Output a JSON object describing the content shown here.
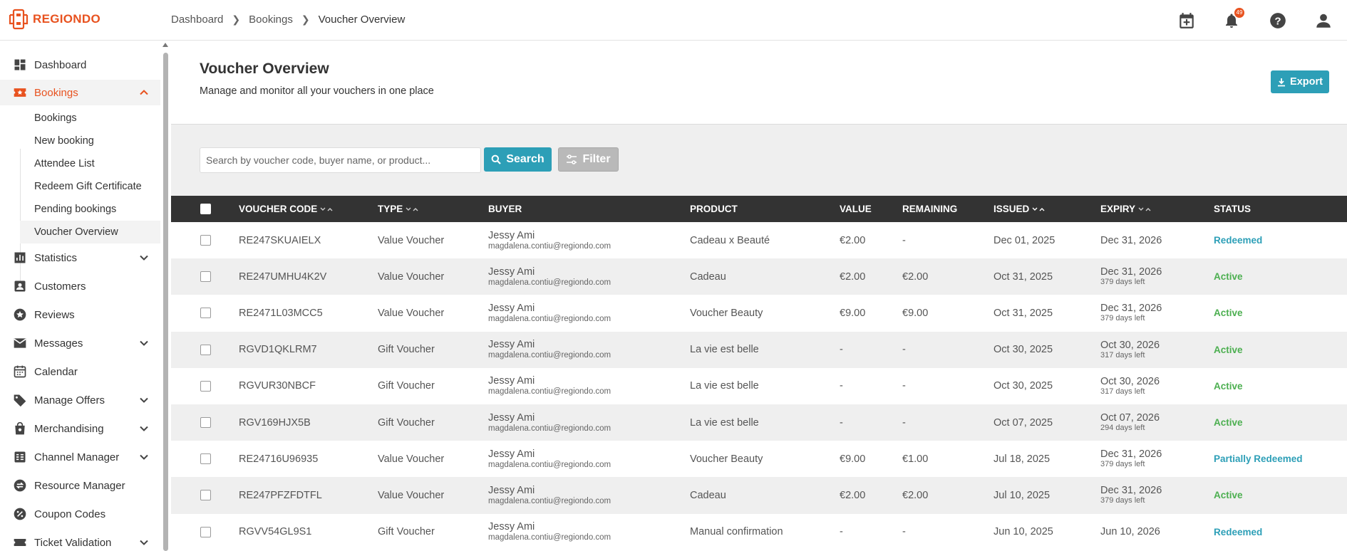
{
  "brand": {
    "name": "REGIONDO",
    "accent": "#e8521f",
    "primary": "#2d9fb7"
  },
  "breadcrumb": [
    "Dashboard",
    "Bookings",
    "Voucher Overview"
  ],
  "notifications": {
    "count": "49"
  },
  "sidebar": {
    "items": [
      {
        "label": "Dashboard",
        "icon": "dashboard-icon"
      },
      {
        "label": "Bookings",
        "icon": "bookings-icon",
        "expanded": true
      },
      {
        "label": "Statistics",
        "icon": "statistics-icon"
      },
      {
        "label": "Customers",
        "icon": "customers-icon"
      },
      {
        "label": "Reviews",
        "icon": "reviews-icon"
      },
      {
        "label": "Messages",
        "icon": "messages-icon"
      },
      {
        "label": "Calendar",
        "icon": "calendar-icon"
      },
      {
        "label": "Manage Offers",
        "icon": "tag-icon"
      },
      {
        "label": "Merchandising",
        "icon": "bag-icon"
      },
      {
        "label": "Channel Manager",
        "icon": "channel-icon"
      },
      {
        "label": "Resource Manager",
        "icon": "resource-icon"
      },
      {
        "label": "Coupon Codes",
        "icon": "coupon-icon"
      },
      {
        "label": "Ticket Validation",
        "icon": "ticket-icon"
      }
    ],
    "sub_items": [
      "Bookings",
      "New booking",
      "Attendee List",
      "Redeem Gift Certificate",
      "Pending bookings",
      "Voucher Overview"
    ]
  },
  "page": {
    "title": "Voucher Overview",
    "subtitle": "Manage and monitor all your vouchers in one place",
    "export_label": "Export"
  },
  "search": {
    "placeholder": "Search by voucher code, buyer name, or product...",
    "search_label": "Search",
    "filter_label": "Filter"
  },
  "table": {
    "columns": [
      "VOUCHER CODE",
      "TYPE",
      "BUYER",
      "PRODUCT",
      "VALUE",
      "REMAINING",
      "ISSUED",
      "EXPIRY",
      "STATUS"
    ],
    "rows": [
      {
        "code": "RE247SKUAIELX",
        "type": "Value Voucher",
        "buyer": "Jessy Ami",
        "email": "magdalena.contiu@regiondo.com",
        "product": "Cadeau x Beauté",
        "value": "€2.00",
        "remaining": "-",
        "issued": "Dec 01, 2025",
        "expiry": "Dec 31, 2026",
        "days_left": "",
        "status": "Redeemed",
        "status_class": "st-redeemed"
      },
      {
        "code": "RE247UMHU4K2V",
        "type": "Value Voucher",
        "buyer": "Jessy Ami",
        "email": "magdalena.contiu@regiondo.com",
        "product": "Cadeau",
        "value": "€2.00",
        "remaining": "€2.00",
        "issued": "Oct 31, 2025",
        "expiry": "Dec 31, 2026",
        "days_left": "379 days left",
        "status": "Active",
        "status_class": "st-active"
      },
      {
        "code": "RE2471L03MCC5",
        "type": "Value Voucher",
        "buyer": "Jessy Ami",
        "email": "magdalena.contiu@regiondo.com",
        "product": "Voucher Beauty",
        "value": "€9.00",
        "remaining": "€9.00",
        "issued": "Oct 31, 2025",
        "expiry": "Dec 31, 2026",
        "days_left": "379 days left",
        "status": "Active",
        "status_class": "st-active"
      },
      {
        "code": "RGVD1QKLRM7",
        "type": "Gift Voucher",
        "buyer": "Jessy Ami",
        "email": "magdalena.contiu@regiondo.com",
        "product": "La vie est belle",
        "value": "-",
        "remaining": "-",
        "issued": "Oct 30, 2025",
        "expiry": "Oct 30, 2026",
        "days_left": "317 days left",
        "status": "Active",
        "status_class": "st-active"
      },
      {
        "code": "RGVUR30NBCF",
        "type": "Gift Voucher",
        "buyer": "Jessy Ami",
        "email": "magdalena.contiu@regiondo.com",
        "product": "La vie est belle",
        "value": "-",
        "remaining": "-",
        "issued": "Oct 30, 2025",
        "expiry": "Oct 30, 2026",
        "days_left": "317 days left",
        "status": "Active",
        "status_class": "st-active"
      },
      {
        "code": "RGV169HJX5B",
        "type": "Gift Voucher",
        "buyer": "Jessy Ami",
        "email": "magdalena.contiu@regiondo.com",
        "product": "La vie est belle",
        "value": "-",
        "remaining": "-",
        "issued": "Oct 07, 2025",
        "expiry": "Oct 07, 2026",
        "days_left": "294 days left",
        "status": "Active",
        "status_class": "st-active"
      },
      {
        "code": "RE24716U96935",
        "type": "Value Voucher",
        "buyer": "Jessy Ami",
        "email": "magdalena.contiu@regiondo.com",
        "product": "Voucher Beauty",
        "value": "€9.00",
        "remaining": "€1.00",
        "issued": "Jul 18, 2025",
        "expiry": "Dec 31, 2026",
        "days_left": "379 days left",
        "status": "Partially Redeemed",
        "status_class": "st-partial"
      },
      {
        "code": "RE247PFZFDTFL",
        "type": "Value Voucher",
        "buyer": "Jessy Ami",
        "email": "magdalena.contiu@regiondo.com",
        "product": "Cadeau",
        "value": "€2.00",
        "remaining": "€2.00",
        "issued": "Jul 10, 2025",
        "expiry": "Dec 31, 2026",
        "days_left": "379 days left",
        "status": "Active",
        "status_class": "st-active"
      },
      {
        "code": "RGVV54GL9S1",
        "type": "Gift Voucher",
        "buyer": "Jessy Ami",
        "email": "magdalena.contiu@regiondo.com",
        "product": "Manual confirmation",
        "value": "-",
        "remaining": "-",
        "issued": "Jun 10, 2025",
        "expiry": "Jun 10, 2026",
        "days_left": "",
        "status": "Redeemed",
        "status_class": "st-redeemed"
      }
    ]
  }
}
